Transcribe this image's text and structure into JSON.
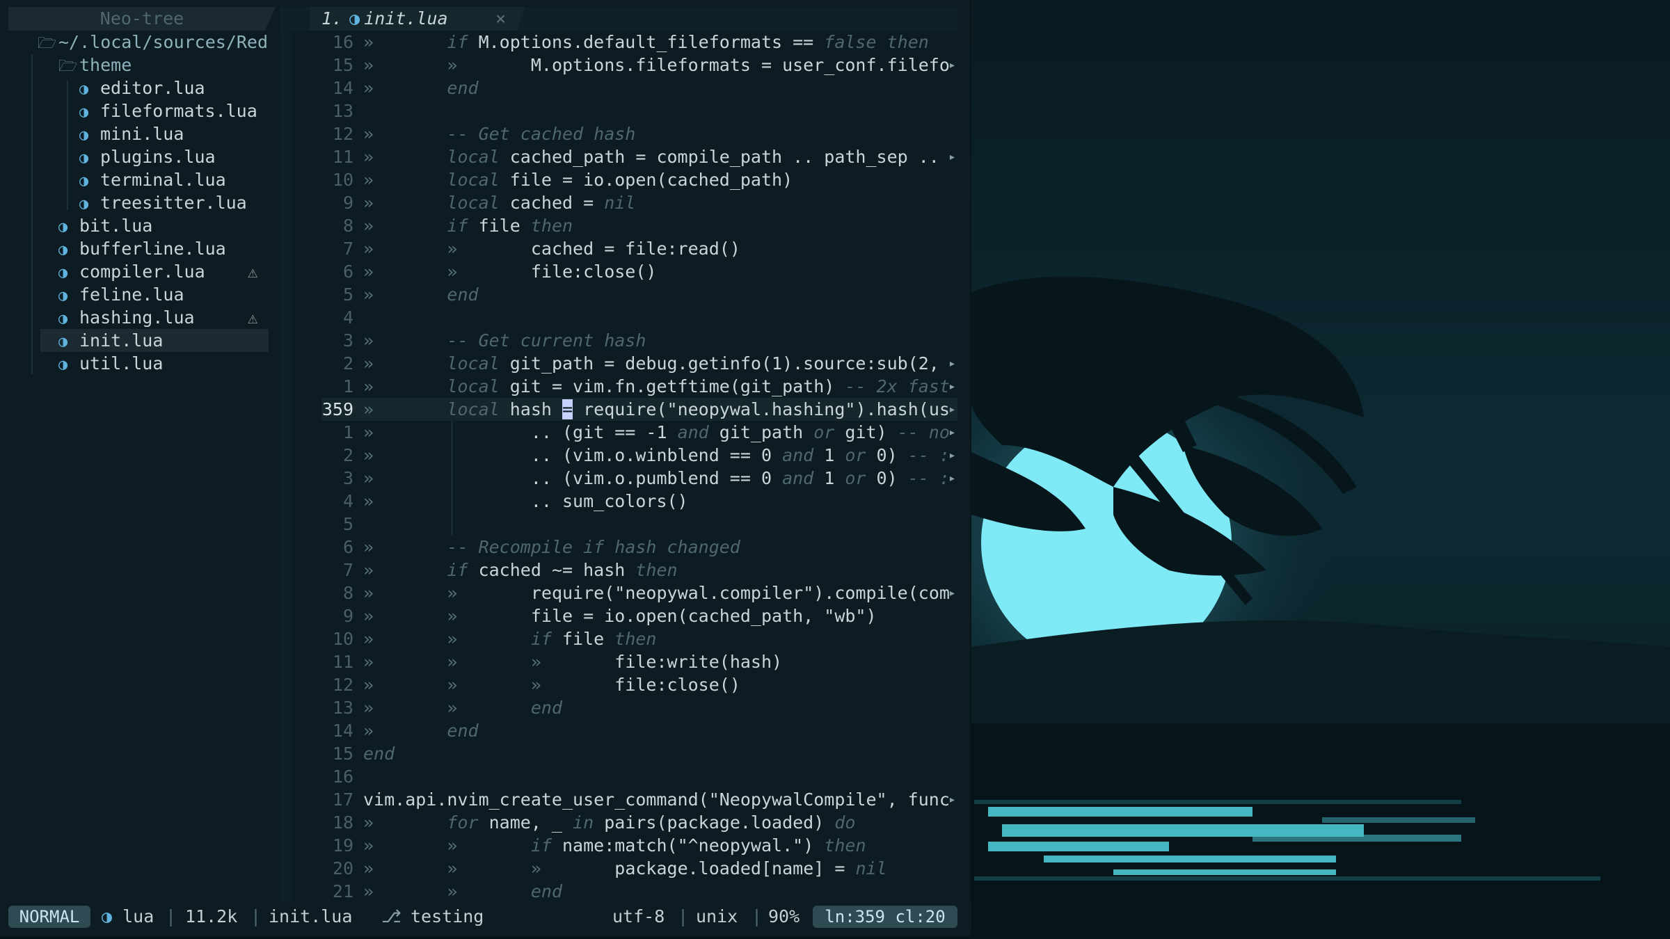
{
  "sidebar": {
    "title": "Neo-tree",
    "root": "~/.local/sources/Red",
    "items": [
      {
        "label": "theme",
        "kind": "dir",
        "depth": 1
      },
      {
        "label": "editor.lua",
        "kind": "file",
        "depth": 2
      },
      {
        "label": "fileformats.lua",
        "kind": "file",
        "depth": 2
      },
      {
        "label": "mini.lua",
        "kind": "file",
        "depth": 2
      },
      {
        "label": "plugins.lua",
        "kind": "file",
        "depth": 2
      },
      {
        "label": "terminal.lua",
        "kind": "file",
        "depth": 2
      },
      {
        "label": "treesitter.lua",
        "kind": "file",
        "depth": 2
      },
      {
        "label": "bit.lua",
        "kind": "file",
        "depth": 1
      },
      {
        "label": "bufferline.lua",
        "kind": "file",
        "depth": 1
      },
      {
        "label": "compiler.lua",
        "kind": "file",
        "depth": 1,
        "warning": true
      },
      {
        "label": "feline.lua",
        "kind": "file",
        "depth": 1
      },
      {
        "label": "hashing.lua",
        "kind": "file",
        "depth": 1,
        "warning": true
      },
      {
        "label": "init.lua",
        "kind": "file",
        "depth": 1,
        "selected": true
      },
      {
        "label": "util.lua",
        "kind": "file",
        "depth": 1
      }
    ],
    "file_icon": "lua-moon-icon",
    "folder_icon": "folder-open-icon",
    "warning_icon": "warning-triangle-icon"
  },
  "tab": {
    "index": "1.",
    "label": "init.lua",
    "close": "×"
  },
  "editor": {
    "lines": [
      {
        "num": "16",
        "code": "»       if M.options.default_fileformats == false then"
      },
      {
        "num": "15",
        "code": "»       »       M.options.fileformats = user_conf.filefo"
      },
      {
        "num": "14",
        "code": "»       end"
      },
      {
        "num": "13",
        "code": ""
      },
      {
        "num": "12",
        "code": "»       -- Get cached hash"
      },
      {
        "num": "11",
        "code": "»       local cached_path = compile_path .. path_sep .. "
      },
      {
        "num": "10",
        "code": "»       local file = io.open(cached_path)"
      },
      {
        "num": "9",
        "code": "»       local cached = nil"
      },
      {
        "num": "8",
        "code": "»       if file then"
      },
      {
        "num": "7",
        "code": "»       »       cached = file:read()"
      },
      {
        "num": "6",
        "code": "»       »       file:close()"
      },
      {
        "num": "5",
        "code": "»       end"
      },
      {
        "num": "4",
        "code": ""
      },
      {
        "num": "3",
        "code": "»       -- Get current hash"
      },
      {
        "num": "2",
        "code": "»       local git_path = debug.getinfo(1).source:sub(2, "
      },
      {
        "num": "1",
        "code": "»       local git = vim.fn.getftime(git_path) -- 2x fast"
      },
      {
        "num": "359",
        "code": "»       local hash = require(\"neopywal.hashing\").hash(us",
        "current": true
      },
      {
        "num": "1",
        "code": "»               .. (git == -1 and git_path or git) -- no"
      },
      {
        "num": "2",
        "code": "»               .. (vim.o.winblend == 0 and 1 or 0) -- :"
      },
      {
        "num": "3",
        "code": "»               .. (vim.o.pumblend == 0 and 1 or 0) -- :"
      },
      {
        "num": "4",
        "code": "»               .. sum_colors()"
      },
      {
        "num": "5",
        "code": ""
      },
      {
        "num": "6",
        "code": "»       -- Recompile if hash changed"
      },
      {
        "num": "7",
        "code": "»       if cached ~= hash then"
      },
      {
        "num": "8",
        "code": "»       »       require(\"neopywal.compiler\").compile(com"
      },
      {
        "num": "9",
        "code": "»       »       file = io.open(cached_path, \"wb\")"
      },
      {
        "num": "10",
        "code": "»       »       if file then"
      },
      {
        "num": "11",
        "code": "»       »       »       file:write(hash)"
      },
      {
        "num": "12",
        "code": "»       »       »       file:close()"
      },
      {
        "num": "13",
        "code": "»       »       end"
      },
      {
        "num": "14",
        "code": "»       end"
      },
      {
        "num": "15",
        "code": "end"
      },
      {
        "num": "16",
        "code": ""
      },
      {
        "num": "17",
        "code": "vim.api.nvim_create_user_command(\"NeopywalCompile\", func"
      },
      {
        "num": "18",
        "code": "»       for name, _ in pairs(package.loaded) do"
      },
      {
        "num": "19",
        "code": "»       »       if name:match(\"^neopywal.\") then"
      },
      {
        "num": "20",
        "code": "»       »       »       package.loaded[name] = nil"
      },
      {
        "num": "21",
        "code": "»       »       end"
      }
    ],
    "truncated_marker": "▸"
  },
  "statusline": {
    "mode": "NORMAL",
    "filetype": "lua",
    "size": "11.2k",
    "filename": "init.lua",
    "branch_icon": "git-branch-icon",
    "branch": "testing",
    "encoding": "utf-8",
    "format": "unix",
    "percent": "90%",
    "position": "ln:359 cl:20",
    "separator": "|"
  },
  "colors": {
    "background": "#0c1c22",
    "accent": "#5fb3de",
    "moon": "#7fe9f5"
  }
}
